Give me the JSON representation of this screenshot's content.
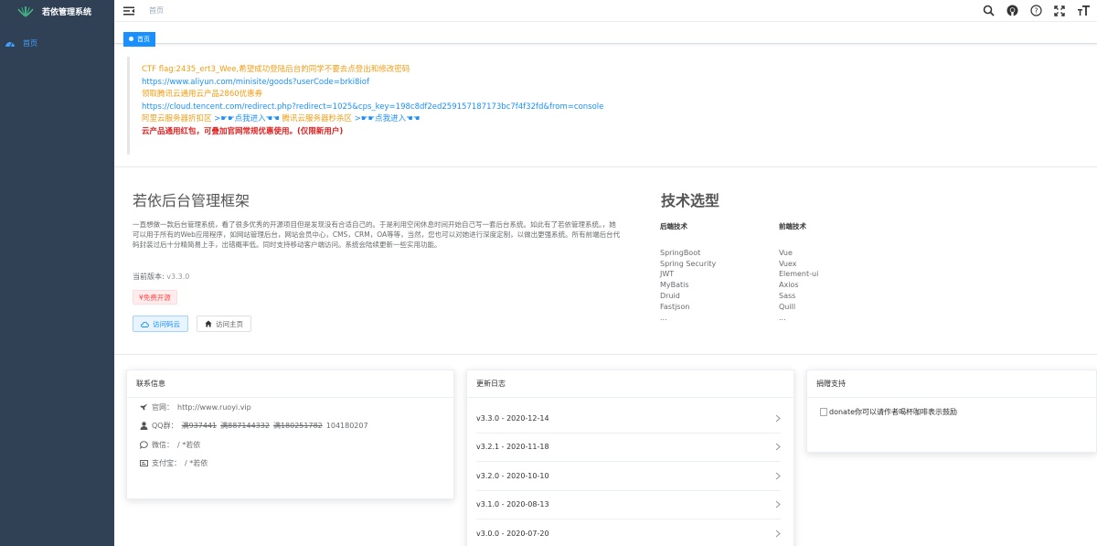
{
  "app": {
    "title": "若依管理系统"
  },
  "sidebar": {
    "items": [
      {
        "label": "首页"
      }
    ]
  },
  "navbar": {
    "breadcrumb": "首页"
  },
  "tags": [
    {
      "label": "首页"
    }
  ],
  "notice": {
    "line1": "CTF flag:2435_ert3_Wee,希望成功登陆后台的同学不要去点登出和修改密码",
    "line2": "https://www.aliyun.com/minisite/goods?userCode=brki8iof",
    "line3": "领取腾讯云通用云产品2860优惠券",
    "line4": "https://cloud.tencent.com/redirect.php?redirect=1025&cps_key=198c8df2ed259157187173bc7f4f32fd&from=console",
    "line5a": "阿里云服务器折扣区",
    "line5b": ">☛☛点我进入☚☚",
    "line5c": "腾讯云服务器秒杀区",
    "line5d": ">☛☛点我进入☚☚",
    "line6": "云产品通用红包，可叠加官网常规优惠使用。(仅限新用户)"
  },
  "intro": {
    "title": "若依后台管理框架",
    "desc": "一直想做一款后台管理系统，看了很多优秀的开源项目但是发现没有合适自己的。于是利用空闲休息时间开始自己写一套后台系统。如此有了若依管理系统。，她可以用于所有的Web应用程序，如网站管理后台，网站会员中心，CMS，CRM，OA等等，当然，您也可以对她进行深度定制，以做出更强系统。所有前端后台代码封装过后十分精简易上手，出错概率低。同时支持移动客户端访问。系统会陆续更新一些实用功能。",
    "version_label": "当前版本:",
    "version": "v3.3.0",
    "free_tag": "¥免费开源",
    "btn_cloud": "访问码云",
    "btn_home": "访问主页"
  },
  "tech": {
    "title": "技术选型",
    "backend_title": "后端技术",
    "backend": [
      "SpringBoot",
      "Spring Security",
      "JWT",
      "MyBatis",
      "Druid",
      "Fastjson",
      "..."
    ],
    "frontend_title": "前端技术",
    "frontend": [
      "Vue",
      "Vuex",
      "Element-ui",
      "Axios",
      "Sass",
      "Quill",
      "..."
    ]
  },
  "contact": {
    "title": "联系信息",
    "site_label": "官网：",
    "site": "http://www.ruoyi.vip",
    "qq_label": "QQ群：",
    "qq_full1": "满937441",
    "qq_full2": "满887144332",
    "qq_full3": "满180251782",
    "qq_open": "104180207",
    "wechat_label": "微信：",
    "wechat": "/ *若依",
    "alipay_label": "支付宝：",
    "alipay": "/ *若依"
  },
  "changelog": {
    "title": "更新日志",
    "items": [
      "v3.3.0 - 2020-12-14",
      "v3.2.1 - 2020-11-18",
      "v3.2.0 - 2020-10-10",
      "v3.1.0 - 2020-08-13",
      "v3.0.0 - 2020-07-20"
    ]
  },
  "donate": {
    "title": "捐赠支持",
    "text": "donate你可以请作者喝杯咖啡表示鼓励"
  },
  "colors": {
    "sidebar_bg": "#304156",
    "accent": "#1890ff",
    "orange": "#f39c12",
    "red": "#e02020"
  }
}
